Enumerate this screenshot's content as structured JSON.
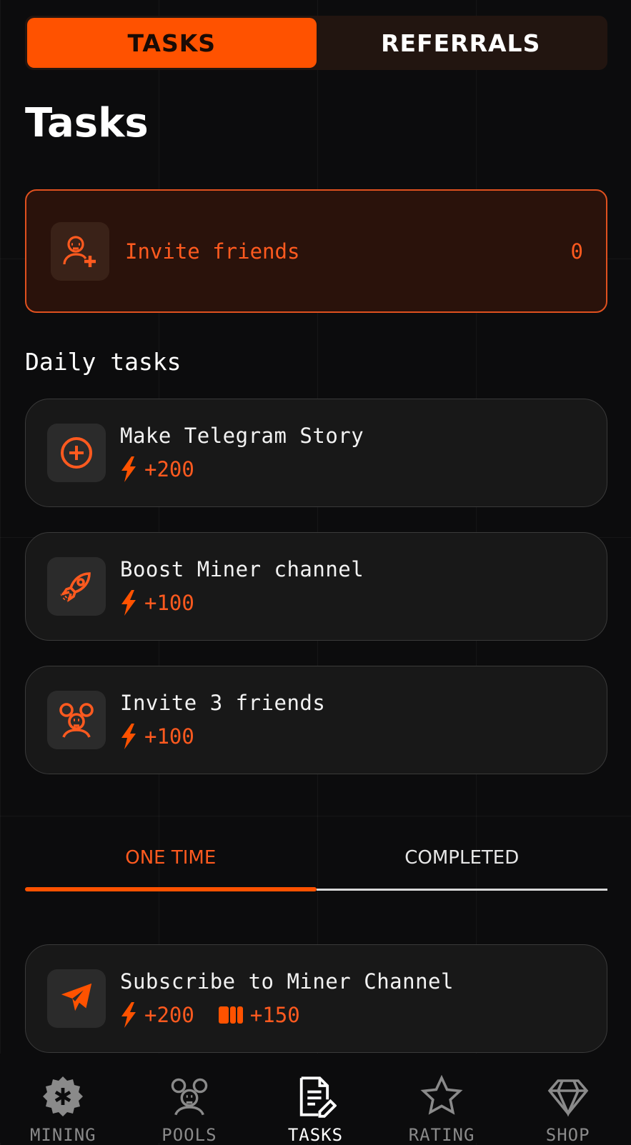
{
  "segmented": {
    "tasks_label": "TASKS",
    "referrals_label": "REFERRALS"
  },
  "page_title": "Tasks",
  "invite_card": {
    "label": "Invite friends",
    "count": "0"
  },
  "daily": {
    "title": "Daily tasks",
    "items": [
      {
        "title": "Make Telegram Story",
        "reward": "+200",
        "icon": "plus-circle-icon"
      },
      {
        "title": "Boost Miner channel",
        "reward": "+100",
        "icon": "rocket-icon"
      },
      {
        "title": "Invite 3 friends",
        "reward": "+100",
        "icon": "group-icon"
      }
    ]
  },
  "tabs": {
    "one_time": "ONE TIME",
    "completed": "COMPLETED"
  },
  "one_time_items": [
    {
      "title": "Subscribe to Miner Channel",
      "reward_energy": "+200",
      "reward_coins": "+150",
      "icon": "telegram-send-icon"
    }
  ],
  "nav": {
    "mining": "MINING",
    "pools": "POOLS",
    "tasks": "TASKS",
    "rating": "RATING",
    "shop": "SHOP"
  },
  "colors": {
    "accent": "#ff5200",
    "accent_text": "#ff5a1f",
    "background": "#0c0c0d",
    "card": "#181818"
  }
}
